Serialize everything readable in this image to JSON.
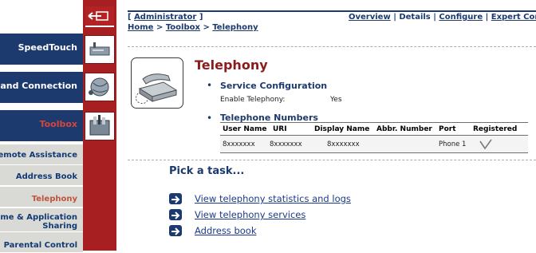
{
  "colors": {
    "nav_band": "#1c3a6e",
    "icon_column": "#a81f22",
    "title": "#8b1c1c",
    "link": "#1a3a8a"
  },
  "nav": {
    "items": [
      {
        "label": "SpeedTouch",
        "icon": "modem-icon"
      },
      {
        "label": "band Connection",
        "icon": "globe-icon"
      },
      {
        "label": "Toolbox",
        "icon": "toolbox-icon",
        "active": true
      }
    ],
    "subitems": [
      {
        "label": "Remote Assistance"
      },
      {
        "label": "Address Book"
      },
      {
        "label": "Telephony",
        "active": true
      },
      {
        "label_line1": "Game & Application",
        "label_line2": "Sharing"
      },
      {
        "label": "Parental Control"
      }
    ]
  },
  "header": {
    "user": "Administrator",
    "breadcrumb": {
      "home": "Home",
      "toolbox": "Toolbox",
      "current": "Telephony"
    },
    "tabs": [
      "Overview",
      "Details",
      "Configure",
      "Expert Config"
    ]
  },
  "page": {
    "title": "Telephony",
    "service_config": {
      "heading": "Service Configuration",
      "label": "Enable Telephony:",
      "value": "Yes"
    },
    "numbers": {
      "heading": "Telephone Numbers",
      "columns": [
        "User Name",
        "URI",
        "Display Name",
        "Abbr. Number",
        "Port",
        "Registered"
      ],
      "rows": [
        {
          "user": "8xxxxxxx",
          "uri": "8xxxxxxx",
          "display": "8xxxxxxx",
          "abbr": "",
          "port": "Phone 1",
          "registered": "check-icon"
        }
      ]
    }
  },
  "tasks": {
    "title": "Pick a task...",
    "links": [
      "View telephony statistics and logs",
      "View telephony services",
      "Address book"
    ]
  }
}
